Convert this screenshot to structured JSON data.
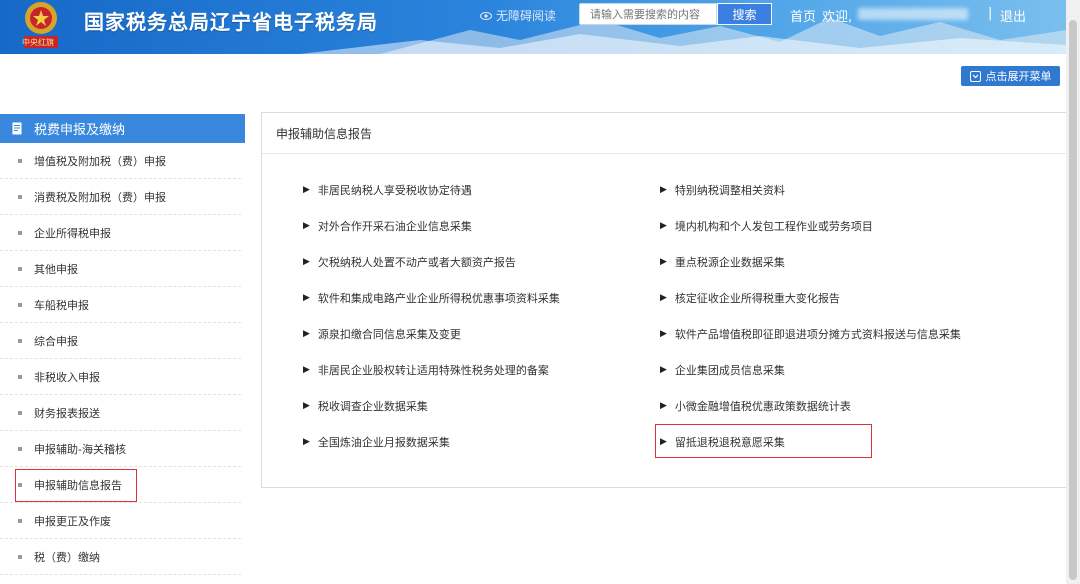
{
  "header": {
    "title": "国家税务总局辽宁省电子税务局",
    "emblem_text": "中央红旗",
    "accessibility_label": "无障碍阅读",
    "search_placeholder": "请输入需要搜索的内容",
    "search_button": "搜索",
    "home_link": "首页",
    "welcome": "欢迎,",
    "separator": "|",
    "logout": "退出"
  },
  "toolbar": {
    "expand_menu": "点击展开菜单"
  },
  "sidebar": {
    "title": "税费申报及缴纳",
    "items": [
      {
        "label": "增值税及附加税（费）申报"
      },
      {
        "label": "消费税及附加税（费）申报"
      },
      {
        "label": "企业所得税申报"
      },
      {
        "label": "其他申报"
      },
      {
        "label": "车船税申报"
      },
      {
        "label": "综合申报"
      },
      {
        "label": "非税收入申报"
      },
      {
        "label": "财务报表报送"
      },
      {
        "label": "申报辅助-海关稽核"
      },
      {
        "label": "申报辅助信息报告"
      },
      {
        "label": "申报更正及作废"
      },
      {
        "label": "税（费）缴纳"
      }
    ]
  },
  "panel": {
    "title": "申报辅助信息报告",
    "left_links": [
      "非居民纳税人享受税收协定待遇",
      "对外合作开采石油企业信息采集",
      "欠税纳税人处置不动产或者大额资产报告",
      "软件和集成电路产业企业所得税优惠事项资料采集",
      "源泉扣缴合同信息采集及变更",
      "非居民企业股权转让适用特殊性税务处理的备案",
      "税收调查企业数据采集",
      "全国炼油企业月报数据采集"
    ],
    "right_links": [
      "特别纳税调整相关资料",
      "境内机构和个人发包工程作业或劳务项目",
      "重点税源企业数据采集",
      "核定征收企业所得税重大变化报告",
      "软件产品增值税即征即退进项分摊方式资料报送与信息采集",
      "企业集团成员信息采集",
      "小微金融增值税优惠政策数据统计表",
      "留抵退税退税意愿采集"
    ]
  },
  "colors": {
    "header_blue": "#1669c7",
    "sidebar_head": "#3a88dd",
    "highlight_red": "#e0303a"
  }
}
